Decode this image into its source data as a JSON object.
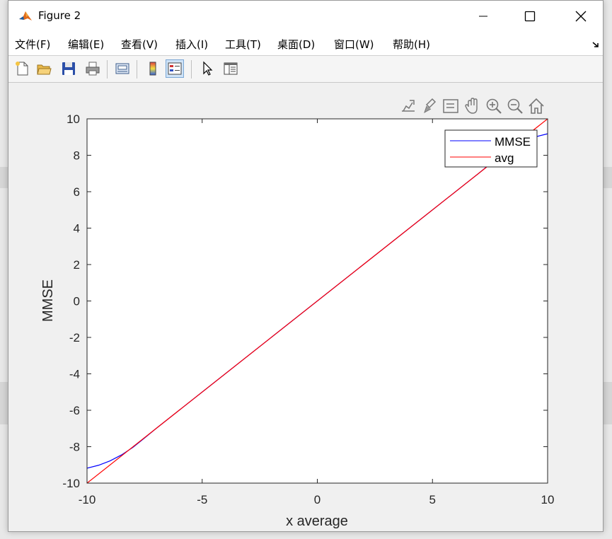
{
  "window": {
    "title": "Figure 2"
  },
  "menu": [
    "文件(F)",
    "编辑(E)",
    "查看(V)",
    "插入(I)",
    "工具(T)",
    "桌面(D)",
    "窗口(W)",
    "帮助(H)"
  ],
  "toolbar_icons": [
    "new-figure-icon",
    "open-file-icon",
    "save-icon",
    "print-icon",
    "link-plot-icon",
    "colorbar-icon",
    "legend-icon",
    "pointer-icon",
    "property-inspector-icon"
  ],
  "axes_toolbar_icons": [
    "export-icon",
    "brush-icon",
    "data-tips-icon",
    "pan-icon",
    "zoom-in-icon",
    "zoom-out-icon",
    "home-icon"
  ],
  "chart_data": {
    "type": "line",
    "xlabel": "x average",
    "ylabel": "MMSE",
    "title": "",
    "xlim": [
      -10,
      10
    ],
    "ylim": [
      -10,
      10
    ],
    "x_ticks": [
      -10,
      -5,
      0,
      5,
      10
    ],
    "y_ticks": [
      -10,
      -8,
      -6,
      -4,
      -2,
      0,
      2,
      4,
      6,
      8,
      10
    ],
    "grid": false,
    "legend_position": "top-right",
    "series": [
      {
        "name": "MMSE",
        "color": "#0000ff",
        "x": [
          -10,
          -9.5,
          -9,
          -8.5,
          -8,
          -7.5,
          -7,
          -6,
          -5,
          -4,
          -2,
          0,
          2,
          4,
          5,
          6,
          7,
          7.5,
          8,
          8.5,
          9,
          9.5,
          10
        ],
        "y": [
          -9.18,
          -9.02,
          -8.78,
          -8.45,
          -8.03,
          -7.52,
          -7.0,
          -6.0,
          -5.0,
          -4.0,
          -2.0,
          0,
          2.0,
          4.0,
          5.0,
          6.0,
          7.0,
          7.52,
          8.03,
          8.45,
          8.78,
          9.02,
          9.18
        ]
      },
      {
        "name": "avg",
        "color": "#ff0000",
        "x": [
          -10,
          10
        ],
        "y": [
          -10,
          10
        ]
      }
    ]
  }
}
